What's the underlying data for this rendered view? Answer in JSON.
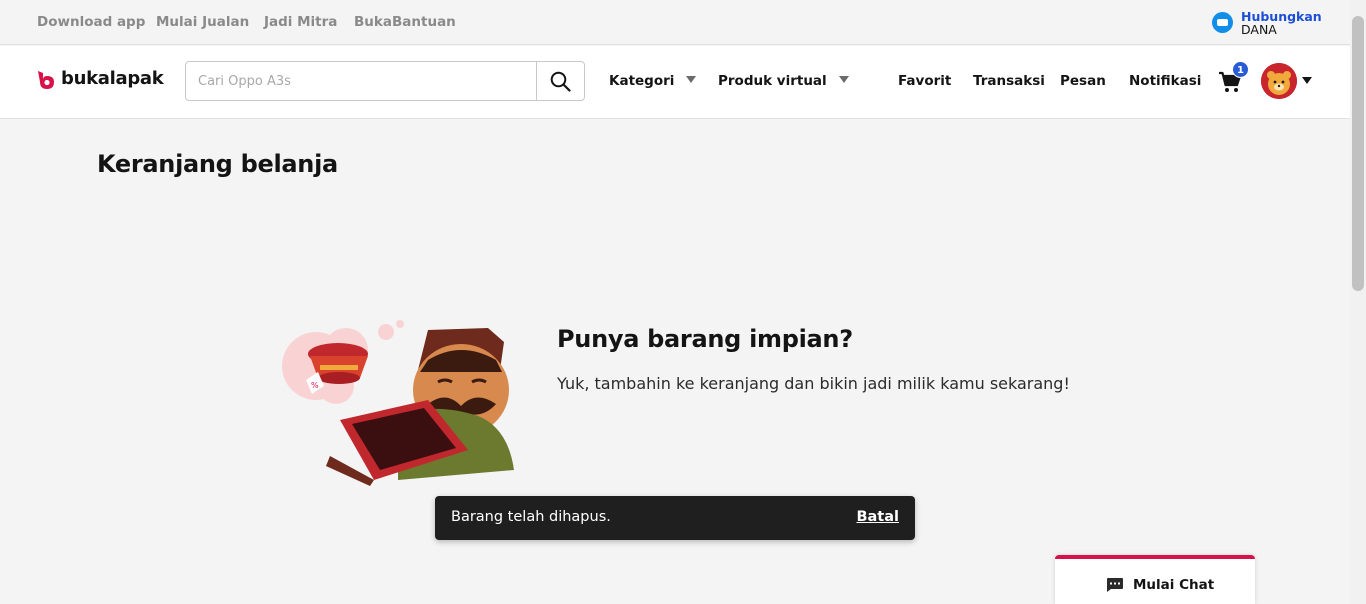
{
  "topbar": {
    "links": [
      "Download app",
      "Mulai Jualan",
      "Jadi Mitra",
      "BukaBantuan"
    ],
    "dana": {
      "line1": "Hubungkan",
      "line2": "DANA"
    }
  },
  "header": {
    "logo": "bukalapak",
    "search": {
      "placeholder": "Cari Oppo A3s",
      "value": ""
    },
    "dropdowns": [
      "Kategori",
      "Produk virtual"
    ],
    "links": [
      "Favorit",
      "Transaksi",
      "Pesan",
      "Notifikasi"
    ],
    "cart_count": "1"
  },
  "main": {
    "page_title": "Keranjang belanja",
    "empty": {
      "title": "Punya barang impian?",
      "description": "Yuk, tambahin ke keranjang dan bikin jadi milik kamu sekarang!"
    }
  },
  "toast": {
    "message": "Barang telah dihapus.",
    "action": "Batal"
  },
  "chat": {
    "label": "Mulai Chat"
  },
  "colors": {
    "brand": "#d71149",
    "badge": "#2a5bd7",
    "dana": "#118eea",
    "toast_bg": "#1f1f1f"
  },
  "icons": [
    "search-icon",
    "caret-down-icon",
    "cart-icon",
    "chat-icon",
    "dana-icon"
  ]
}
